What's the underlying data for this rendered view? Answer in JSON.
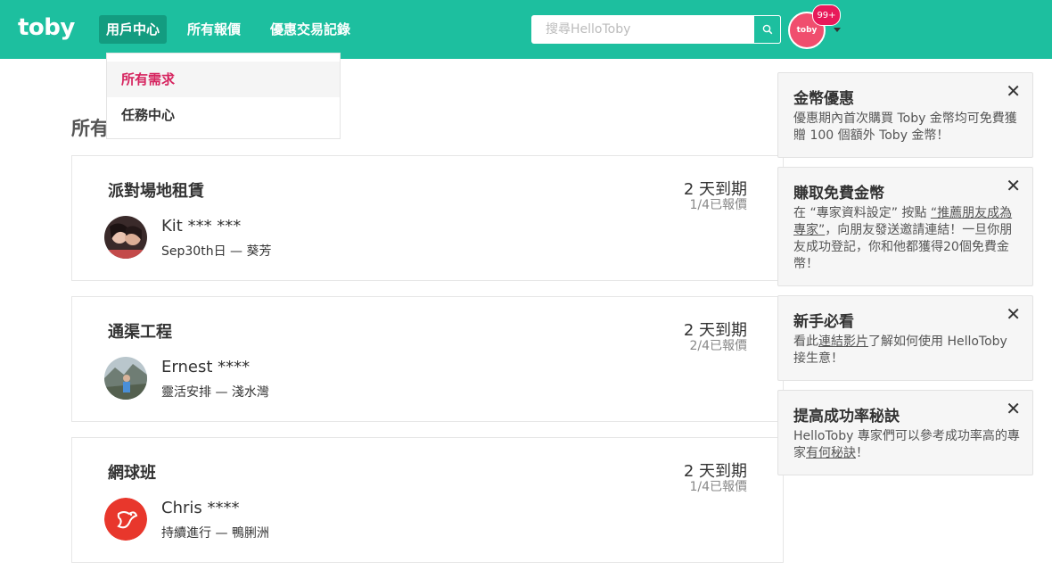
{
  "header": {
    "logo": "toby",
    "nav": [
      {
        "label": "用戶中心"
      },
      {
        "label": "所有報價"
      },
      {
        "label": "優惠交易記錄"
      }
    ],
    "search": {
      "placeholder": "搜尋HelloToby",
      "value": ""
    },
    "avatar_text": "toby",
    "badge": "99+"
  },
  "dropdown": {
    "items": [
      {
        "label": "所有需求"
      },
      {
        "label": "任務中心"
      }
    ]
  },
  "page": {
    "title": "所有"
  },
  "requests": [
    {
      "title": "派對場地租賃",
      "due": "2 天到期",
      "quotes": "1/4已報價",
      "name": "Kit *** ***",
      "meta": "Sep30th日 — 葵芳"
    },
    {
      "title": "通渠工程",
      "due": "2 天到期",
      "quotes": "2/4已報價",
      "name": "Ernest ****",
      "meta": "靈活安排 — 淺水灣"
    },
    {
      "title": "網球班",
      "due": "2 天到期",
      "quotes": "1/4已報價",
      "name": "Chris ****",
      "meta": "持續進行 — 鴨脷洲"
    }
  ],
  "notifications": [
    {
      "title": "金幣優惠",
      "body": "優惠期內首次購買 Toby 金幣均可免費獲贈 100 個額外 Toby 金幣！"
    },
    {
      "title": "賺取免費金幣",
      "body_pre": "在 “專家資料設定” 按點 ",
      "link": "“推薦朋友成為專家”",
      "body_post": "，向朋友發送邀請連結！一旦你朋友成功登記，你和他都獲得20個免費金幣！"
    },
    {
      "title": "新手必看",
      "body_pre": "看此",
      "link": "連結影片",
      "body_post": "了解如何使用 HelloToby 接生意！"
    },
    {
      "title": "提高成功率秘訣",
      "body_pre": "HelloToby 專家們可以參考成功率高的專家",
      "link": "有何秘訣",
      "body_post": "！"
    }
  ],
  "colors": {
    "brand": "#1dbf9f",
    "accent": "#d6245f",
    "badge": "#e8195a"
  }
}
